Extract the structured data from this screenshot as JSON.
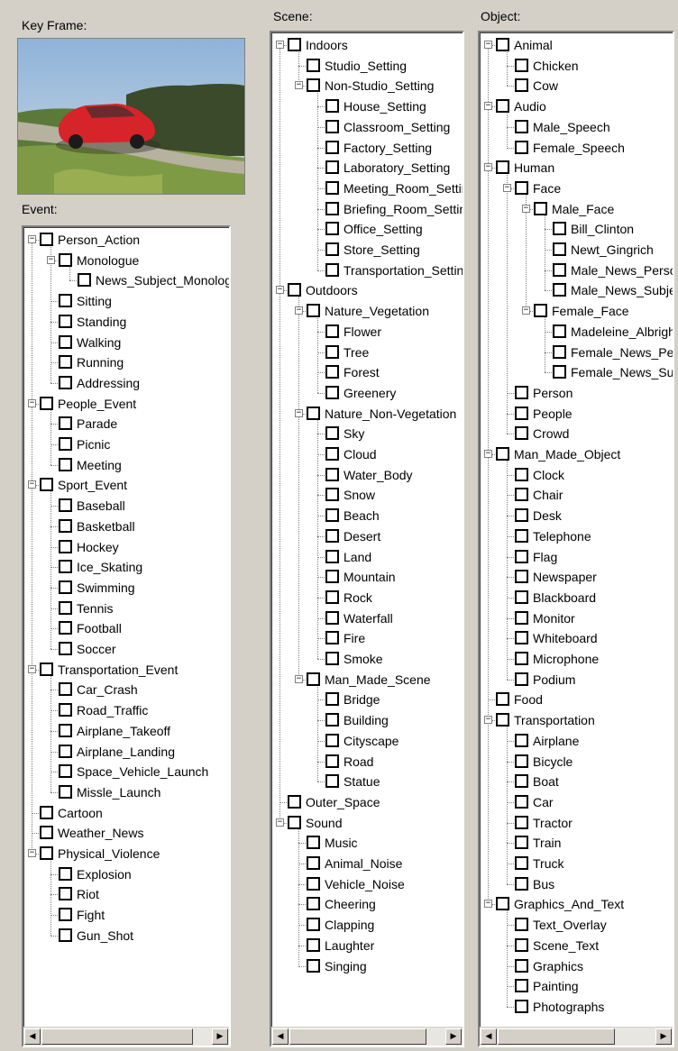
{
  "labels": {
    "key_frame": "Key Frame:",
    "event": "Event:",
    "scene": "Scene:",
    "object": "Object:"
  },
  "scroll": {
    "left_arrow": "◀",
    "right_arrow": "▶"
  },
  "trees": {
    "event": [
      {
        "label": "Person_Action",
        "children": [
          {
            "label": "Monologue",
            "children": [
              {
                "label": "News_Subject_Monologue"
              }
            ]
          },
          {
            "label": "Sitting"
          },
          {
            "label": "Standing"
          },
          {
            "label": "Walking"
          },
          {
            "label": "Running"
          },
          {
            "label": "Addressing"
          }
        ]
      },
      {
        "label": "People_Event",
        "children": [
          {
            "label": "Parade"
          },
          {
            "label": "Picnic"
          },
          {
            "label": "Meeting"
          }
        ]
      },
      {
        "label": "Sport_Event",
        "children": [
          {
            "label": "Baseball"
          },
          {
            "label": "Basketball"
          },
          {
            "label": "Hockey"
          },
          {
            "label": "Ice_Skating"
          },
          {
            "label": "Swimming"
          },
          {
            "label": "Tennis"
          },
          {
            "label": "Football"
          },
          {
            "label": "Soccer"
          }
        ]
      },
      {
        "label": "Transportation_Event",
        "children": [
          {
            "label": "Car_Crash"
          },
          {
            "label": "Road_Traffic"
          },
          {
            "label": "Airplane_Takeoff"
          },
          {
            "label": "Airplane_Landing"
          },
          {
            "label": "Space_Vehicle_Launch"
          },
          {
            "label": "Missle_Launch"
          }
        ]
      },
      {
        "label": "Cartoon"
      },
      {
        "label": "Weather_News"
      },
      {
        "label": "Physical_Violence",
        "children": [
          {
            "label": "Explosion"
          },
          {
            "label": "Riot"
          },
          {
            "label": "Fight"
          },
          {
            "label": "Gun_Shot"
          }
        ]
      }
    ],
    "scene": [
      {
        "label": "Indoors",
        "children": [
          {
            "label": "Studio_Setting"
          },
          {
            "label": "Non-Studio_Setting",
            "children": [
              {
                "label": "House_Setting"
              },
              {
                "label": "Classroom_Setting"
              },
              {
                "label": "Factory_Setting"
              },
              {
                "label": "Laboratory_Setting"
              },
              {
                "label": "Meeting_Room_Setting"
              },
              {
                "label": "Briefing_Room_Setting"
              },
              {
                "label": "Office_Setting"
              },
              {
                "label": "Store_Setting"
              },
              {
                "label": "Transportation_Setting"
              }
            ]
          }
        ]
      },
      {
        "label": "Outdoors",
        "children": [
          {
            "label": "Nature_Vegetation",
            "children": [
              {
                "label": "Flower"
              },
              {
                "label": "Tree"
              },
              {
                "label": "Forest"
              },
              {
                "label": "Greenery"
              }
            ]
          },
          {
            "label": "Nature_Non-Vegetation",
            "children": [
              {
                "label": "Sky"
              },
              {
                "label": "Cloud"
              },
              {
                "label": "Water_Body"
              },
              {
                "label": "Snow"
              },
              {
                "label": "Beach"
              },
              {
                "label": "Desert"
              },
              {
                "label": "Land"
              },
              {
                "label": "Mountain"
              },
              {
                "label": "Rock"
              },
              {
                "label": "Waterfall"
              },
              {
                "label": "Fire"
              },
              {
                "label": "Smoke"
              }
            ]
          },
          {
            "label": "Man_Made_Scene",
            "children": [
              {
                "label": "Bridge"
              },
              {
                "label": "Building"
              },
              {
                "label": "Cityscape"
              },
              {
                "label": "Road"
              },
              {
                "label": "Statue"
              }
            ]
          }
        ]
      },
      {
        "label": "Outer_Space"
      },
      {
        "label": "Sound",
        "children": [
          {
            "label": "Music"
          },
          {
            "label": "Animal_Noise"
          },
          {
            "label": "Vehicle_Noise"
          },
          {
            "label": "Cheering"
          },
          {
            "label": "Clapping"
          },
          {
            "label": "Laughter"
          },
          {
            "label": "Singing"
          }
        ]
      }
    ],
    "object": [
      {
        "label": "Animal",
        "children": [
          {
            "label": "Chicken"
          },
          {
            "label": "Cow"
          }
        ]
      },
      {
        "label": "Audio",
        "children": [
          {
            "label": "Male_Speech"
          },
          {
            "label": "Female_Speech"
          }
        ]
      },
      {
        "label": "Human",
        "children": [
          {
            "label": "Face",
            "children": [
              {
                "label": "Male_Face",
                "children": [
                  {
                    "label": "Bill_Clinton"
                  },
                  {
                    "label": "Newt_Gingrich"
                  },
                  {
                    "label": "Male_News_Person"
                  },
                  {
                    "label": "Male_News_Subject"
                  }
                ]
              },
              {
                "label": "Female_Face",
                "children": [
                  {
                    "label": "Madeleine_Albright"
                  },
                  {
                    "label": "Female_News_Person"
                  },
                  {
                    "label": "Female_News_Subject"
                  }
                ]
              }
            ]
          },
          {
            "label": "Person"
          },
          {
            "label": "People"
          },
          {
            "label": "Crowd"
          }
        ]
      },
      {
        "label": "Man_Made_Object",
        "children": [
          {
            "label": "Clock"
          },
          {
            "label": "Chair"
          },
          {
            "label": "Desk"
          },
          {
            "label": "Telephone"
          },
          {
            "label": "Flag"
          },
          {
            "label": "Newspaper"
          },
          {
            "label": "Blackboard"
          },
          {
            "label": "Monitor"
          },
          {
            "label": "Whiteboard"
          },
          {
            "label": "Microphone"
          },
          {
            "label": "Podium"
          }
        ]
      },
      {
        "label": "Food"
      },
      {
        "label": "Transportation",
        "children": [
          {
            "label": "Airplane"
          },
          {
            "label": "Bicycle"
          },
          {
            "label": "Boat"
          },
          {
            "label": "Car"
          },
          {
            "label": "Tractor"
          },
          {
            "label": "Train"
          },
          {
            "label": "Truck"
          },
          {
            "label": "Bus"
          }
        ]
      },
      {
        "label": "Graphics_And_Text",
        "children": [
          {
            "label": "Text_Overlay"
          },
          {
            "label": "Scene_Text"
          },
          {
            "label": "Graphics"
          },
          {
            "label": "Painting"
          },
          {
            "label": "Photographs"
          }
        ]
      }
    ]
  }
}
